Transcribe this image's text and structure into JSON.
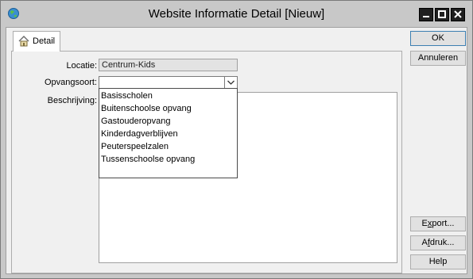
{
  "window": {
    "title": "Website Informatie Detail [Nieuw]",
    "icon": "globe-icon"
  },
  "tabs": [
    {
      "label": "Detail",
      "icon": "house-icon",
      "selected": true
    }
  ],
  "form": {
    "locatie_label": "Locatie:",
    "locatie_value": "Centrum-Kids",
    "opvangsoort_label": "Opvangsoort:",
    "opvangsoort_value": "",
    "beschrijving_label": "Beschrijving:",
    "beschrijving_value": ""
  },
  "dropdown_options": [
    "Basisscholen",
    "Buitenschoolse opvang",
    "Gastouderopvang",
    "Kinderdagverblijven",
    "Peuterspeelzalen",
    "Tussenschoolse opvang"
  ],
  "buttons": {
    "ok": "OK",
    "annuleren": "Annuleren",
    "export_pre": "E",
    "export_ul": "x",
    "export_post": "port...",
    "afdruk_pre": "A",
    "afdruk_ul": "f",
    "afdruk_post": "druk...",
    "help": "Help"
  },
  "colors": {
    "titlebar": "#c8c8c8",
    "client": "#f0f0f0",
    "ok_border": "#3c7fb1"
  }
}
